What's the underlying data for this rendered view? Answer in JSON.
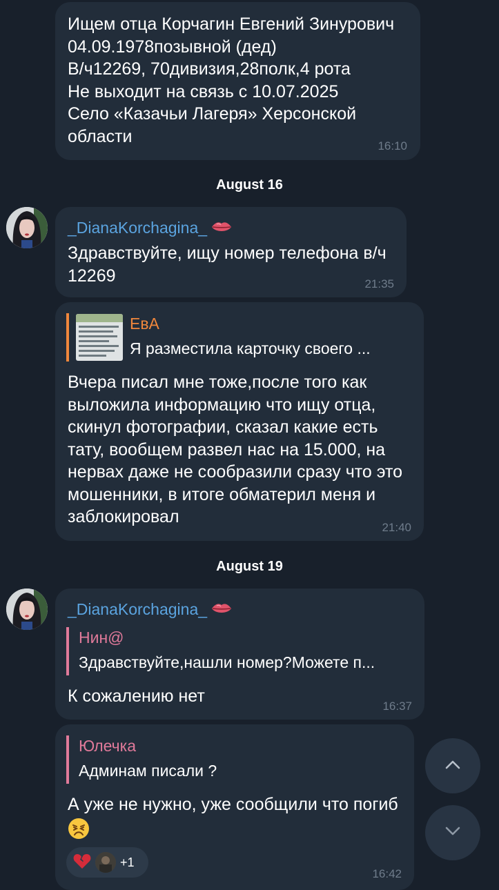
{
  "colors": {
    "background": "#18202b",
    "bubble": "#222d3a",
    "sender_name": "#5ba4e0",
    "reply_accent_pink": "#e07a9a",
    "reply_accent_orange": "#f0873c",
    "timestamp": "#6f7c8b"
  },
  "messages": [
    {
      "lines": [
        "Ищем отца Корчагин Евгений Зинурович",
        "04.09.1978позывной (дед)",
        "В/ч12269, 70дивизия,28полк,4 рота",
        "Не выходит на связь с 10.07.2025",
        "Село «Казачьи Лагеря» Херсонской",
        "области"
      ],
      "time": "16:10"
    },
    {
      "sender": "_DianaKorchagina_",
      "sender_emoji": "lips-icon",
      "lines": [
        "Здравствуйте, ищу номер телефона в/ч",
        "12269"
      ],
      "time": "21:35"
    },
    {
      "reply": {
        "name": "ЕвА",
        "text": "Я разместила карточку своего ..."
      },
      "lines": [
        "Вчера писал мне тоже,после того как",
        "выложила информацию что ищу отца,",
        "скинул фотографии, сказал какие есть",
        "тату, вообщем развел нас на 15.000, на",
        "нервах даже не сообразили сразу что это",
        "мошенники, в итоге обматерил меня и",
        "заблокировал"
      ],
      "time": "21:40"
    },
    {
      "sender": "_DianaKorchagina_",
      "sender_emoji": "lips-icon",
      "reply": {
        "name": "Нин@",
        "text": "Здравствуйте,нашли номер?Можете п..."
      },
      "lines": [
        "К сожалению нет"
      ],
      "time": "16:37"
    },
    {
      "reply": {
        "name": "Юлечка",
        "text": "Админам писали ?"
      },
      "lines": [
        "А уже не нужно, уже сообщили что погиб"
      ],
      "emoji": "sad-face-emoji",
      "reactions": {
        "emoji": "broken-heart-icon",
        "count": "+1"
      },
      "time": "16:42"
    }
  ],
  "date_separators": [
    "August 16",
    "August 19"
  ],
  "controls": {
    "scroll_up_icon": "chevron-up-icon",
    "scroll_down_icon": "chevron-down-icon"
  }
}
